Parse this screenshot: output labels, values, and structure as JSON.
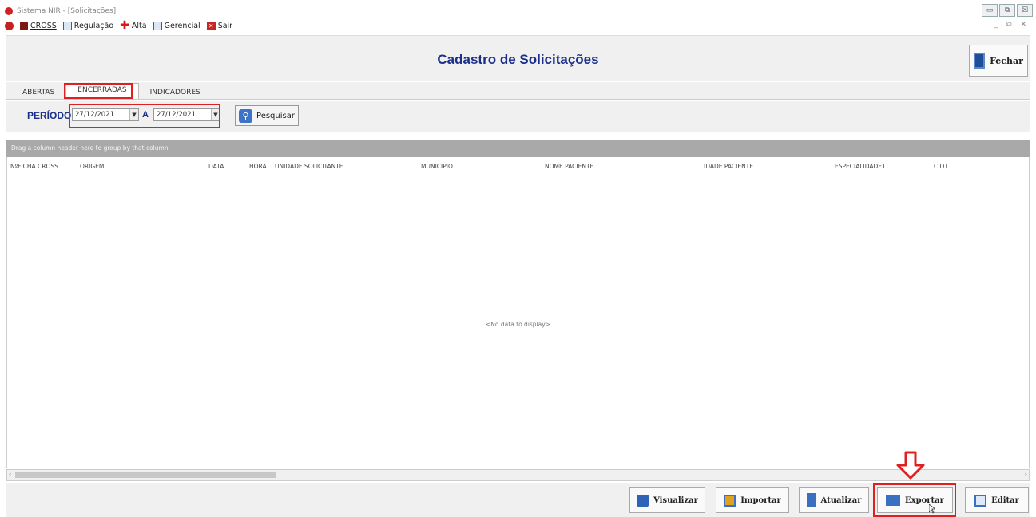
{
  "window": {
    "title": "Sistema NIR - [Solicitações]"
  },
  "menu": {
    "items": [
      {
        "label": "CROSS",
        "icon": "lock-icon"
      },
      {
        "label": "Regulação",
        "icon": "document-icon"
      },
      {
        "label": "Alta",
        "icon": "plus-icon"
      },
      {
        "label": "Gerencial",
        "icon": "chart-icon"
      },
      {
        "label": "Sair",
        "icon": "exit-icon"
      }
    ]
  },
  "header": {
    "title": "Cadastro de Solicitações",
    "close_label": "Fechar"
  },
  "tabs": [
    {
      "label": "ABERTAS"
    },
    {
      "label": "ENCERRADAS",
      "active": true
    },
    {
      "label": "INDICADORES"
    }
  ],
  "filter": {
    "periodo_label": "PERÍODO:",
    "date_from": "27/12/2021",
    "a_label": "A",
    "date_to": "27/12/2021",
    "search_label": "Pesquisar"
  },
  "grid": {
    "group_hint": "Drag a column header here to group by that column",
    "columns": [
      "NºFICHA CROSS",
      "ORIGEM",
      "DATA",
      "HORA",
      "UNIDADE SOLICITANTE",
      "MUNICIPIO",
      "NOME PACIENTE",
      "IDADE PACIENTE",
      "ESPECIALIDADE1",
      "CID1"
    ],
    "empty_text": "<No data to display>"
  },
  "footer": {
    "buttons": [
      {
        "label": "Visualizar",
        "icon": "view-icon"
      },
      {
        "label": "Importar",
        "icon": "import-icon"
      },
      {
        "label": "Atualizar",
        "icon": "refresh-icon"
      },
      {
        "label": "Exportar",
        "icon": "export-icon"
      },
      {
        "label": "Editar",
        "icon": "edit-icon"
      }
    ]
  },
  "colors": {
    "title_blue": "#1a2e8a",
    "highlight_red": "#e02020",
    "group_panel": "#a9a9a9"
  }
}
